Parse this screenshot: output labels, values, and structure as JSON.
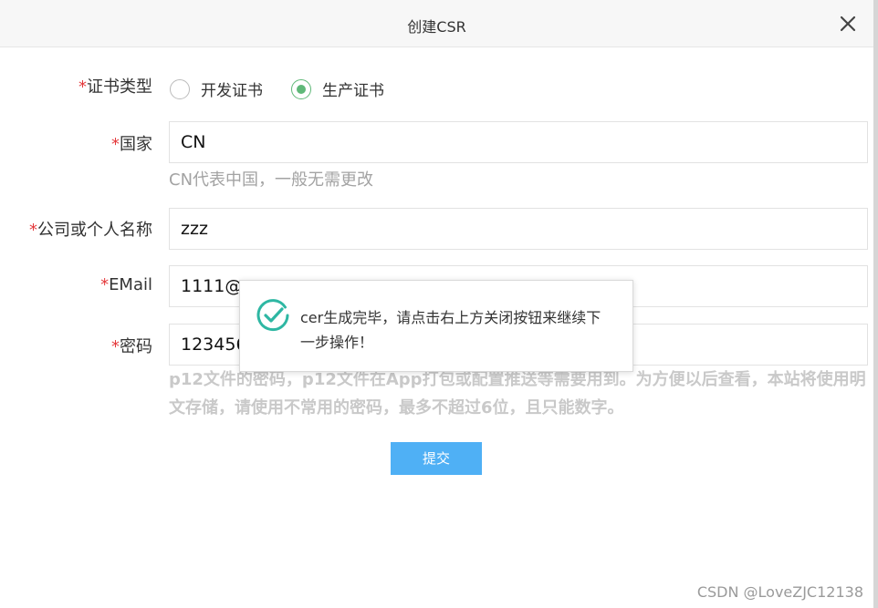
{
  "dialog": {
    "title": "创建CSR"
  },
  "form": {
    "cert_type": {
      "required_mark": "*",
      "label": "证书类型",
      "options": [
        {
          "label": "开发证书",
          "checked": false
        },
        {
          "label": "生产证书",
          "checked": true
        }
      ]
    },
    "country": {
      "required_mark": "*",
      "label": "国家",
      "value": "CN",
      "hint": "CN代表中国，一般无需更改"
    },
    "company": {
      "required_mark": "*",
      "label": "公司或个人名称",
      "value": "zzz"
    },
    "email": {
      "required_mark": "*",
      "label": "EMail",
      "value": "1111@"
    },
    "password": {
      "required_mark": "*",
      "label": "密码",
      "value": "123456",
      "hint": "p12文件的密码，p12文件在App打包或配置推送等需要用到。为方便以后查看，本站将使用明文存储，请使用不常用的密码，最多不超过6位，且只能数字。"
    },
    "submit_label": "提交"
  },
  "toast": {
    "message": "cer生成完毕，请点击右上方关闭按钮来继续下一步操作！",
    "icon": "check-circle-icon"
  },
  "watermark": "CSDN @LoveZJC12138",
  "colors": {
    "accent_green": "#5fb878",
    "button_blue": "#4fb0f5",
    "required_red": "#e4393c"
  }
}
